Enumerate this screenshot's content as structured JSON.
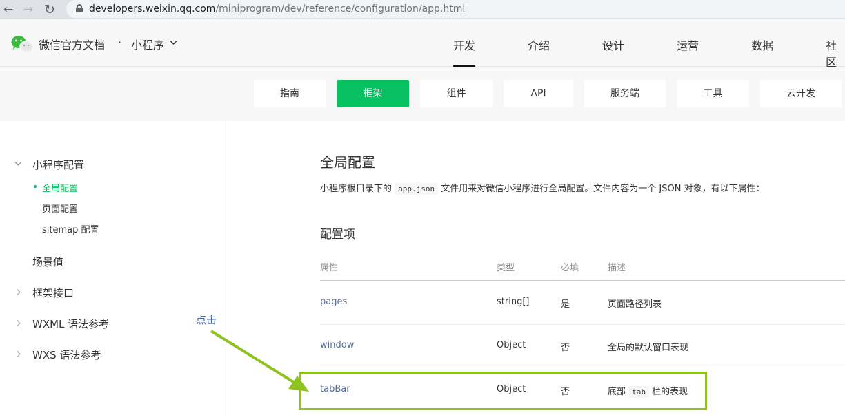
{
  "browser": {
    "url_host": "developers.weixin.qq.com",
    "url_path": "/miniprogram/dev/reference/configuration/app.html"
  },
  "header": {
    "site_name": "微信官方文档",
    "separator": "·",
    "product": "小程序",
    "nav": [
      "开发",
      "介绍",
      "设计",
      "运营",
      "数据",
      "社区"
    ]
  },
  "subnav": {
    "tabs": [
      "指南",
      "框架",
      "组件",
      "API",
      "服务端",
      "工具",
      "云开发"
    ]
  },
  "sidebar": {
    "section_title": "小程序配置",
    "sub_items": [
      "全局配置",
      "页面配置",
      "sitemap 配置"
    ],
    "items": [
      "场景值",
      "框架接口",
      "WXML 语法参考",
      "WXS 语法参考"
    ]
  },
  "content": {
    "title": "全局配置",
    "intro_before": "小程序根目录下的",
    "intro_code": "app.json",
    "intro_after": "文件用来对微信小程序进行全局配置。文件内容为一个 JSON 对象，有以下属性：",
    "section_title": "配置项",
    "table": {
      "headers": [
        "属性",
        "类型",
        "必填",
        "描述"
      ],
      "rows": [
        {
          "prop": "pages",
          "type": "string[]",
          "required": "是",
          "desc": "页面路径列表"
        },
        {
          "prop": "window",
          "type": "Object",
          "required": "否",
          "desc": "全局的默认窗口表现"
        },
        {
          "prop": "tabBar",
          "type": "Object",
          "required": "否",
          "desc_before": "底部",
          "desc_code": "tab",
          "desc_after": "栏的表现"
        }
      ]
    }
  },
  "annotation": {
    "label": "点击",
    "color": "#8dc21f"
  },
  "colors": {
    "accent": "#07c160",
    "link": "#576b95"
  }
}
